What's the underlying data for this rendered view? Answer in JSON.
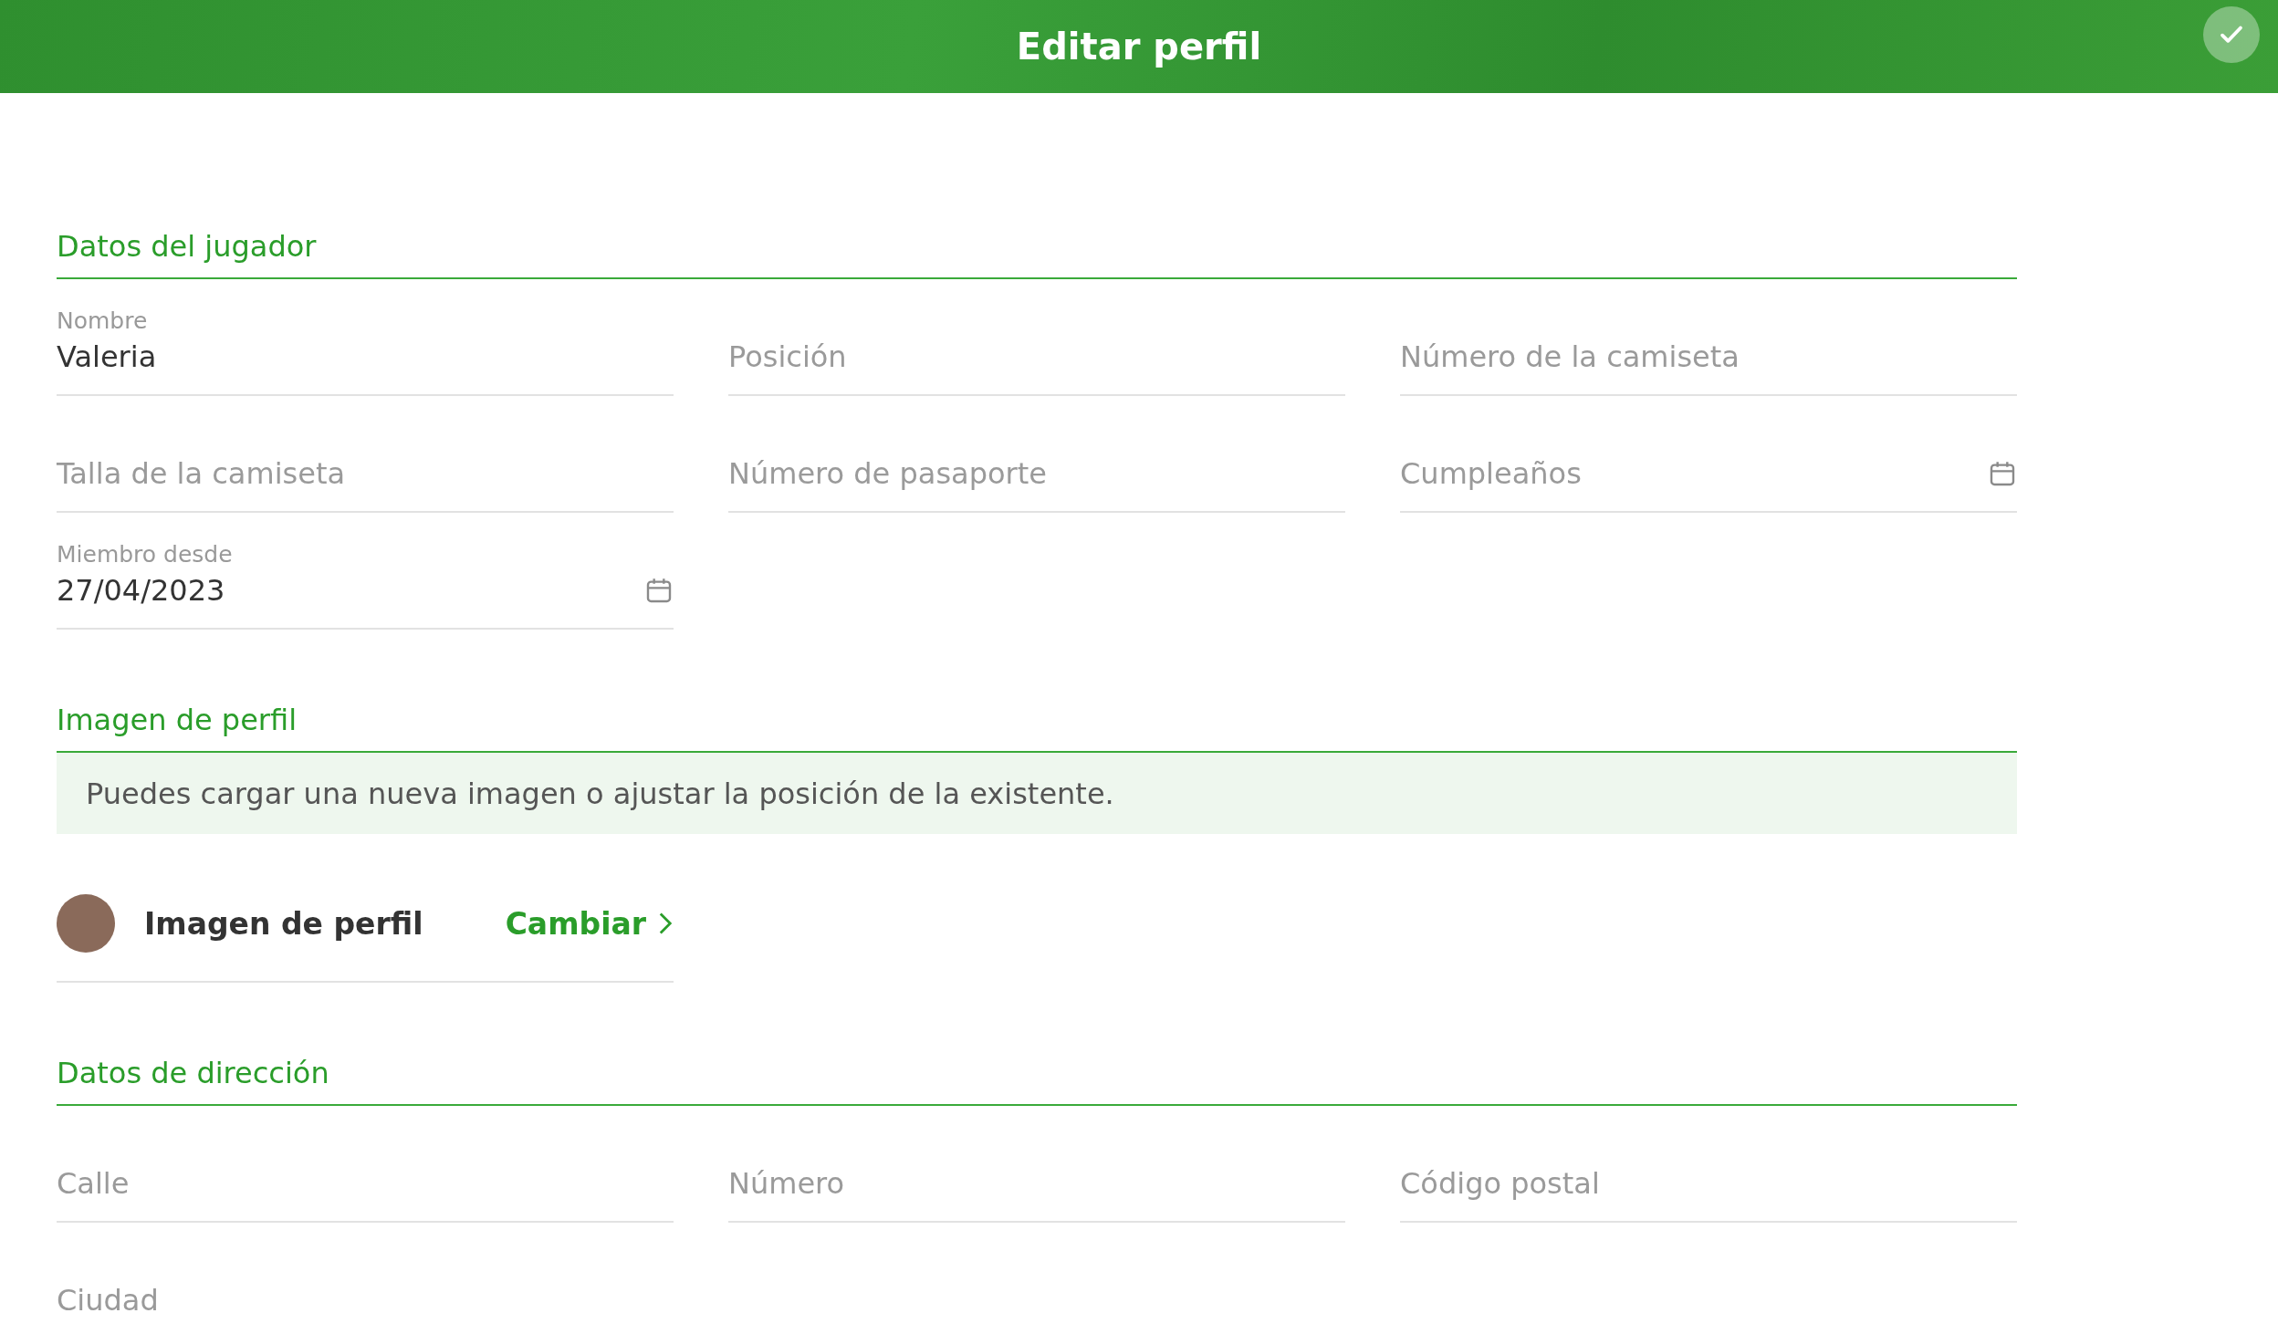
{
  "header": {
    "title": "Editar perfil"
  },
  "sections": [
    {
      "title": "Datos del jugador",
      "kind": "fields",
      "fields": [
        {
          "kind": "text",
          "label": "Nombre",
          "value": "Valeria"
        },
        {
          "kind": "text",
          "placeholder": "Posición"
        },
        {
          "kind": "text",
          "placeholder": "Número de la camiseta"
        },
        {
          "kind": "text",
          "placeholder": "Talla de la camiseta"
        },
        {
          "kind": "text",
          "placeholder": "Número de pasaporte"
        },
        {
          "kind": "date",
          "placeholder": "Cumpleaños"
        },
        {
          "kind": "date",
          "label": "Miembro desde",
          "value": "27/04/2023"
        }
      ]
    },
    {
      "title": "Imagen de perfil",
      "kind": "image",
      "info": "Puedes cargar una nueva imagen o ajustar la posición de la existente.",
      "label": "Imagen de perfil",
      "action": "Cambiar"
    },
    {
      "title": "Datos de dirección",
      "kind": "fields",
      "fields": [
        {
          "kind": "text",
          "placeholder": "Calle"
        },
        {
          "kind": "text",
          "placeholder": "Número"
        },
        {
          "kind": "text",
          "placeholder": "Código postal"
        },
        {
          "kind": "text",
          "placeholder": "Ciudad"
        }
      ]
    }
  ]
}
